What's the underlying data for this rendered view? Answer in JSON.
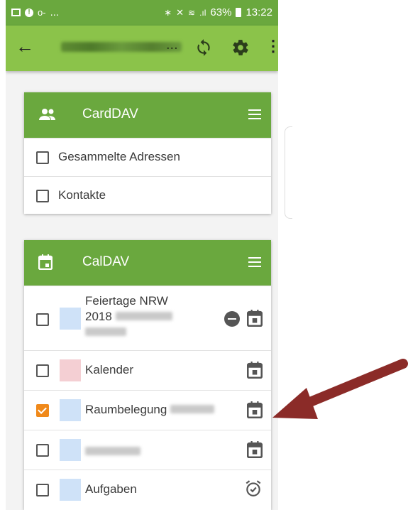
{
  "status_bar": {
    "left_icons": [
      "image-icon",
      "alert-icon",
      "key-icon"
    ],
    "left_text": "...",
    "right_text": "63%",
    "time": "13:22"
  },
  "appbar": {
    "back_icon": "arrow-back-icon",
    "title_visible": "...",
    "actions": [
      "sync-icon",
      "settings-icon",
      "more-icon"
    ]
  },
  "carddav": {
    "title": "CardDAV",
    "items": [
      {
        "label": "Gesammelte Adressen",
        "checked": false
      },
      {
        "label": "Kontakte",
        "checked": false
      }
    ]
  },
  "caldav": {
    "title": "CalDAV",
    "items": [
      {
        "line1": "Feiertage NRW",
        "line2": "2018",
        "checked": false,
        "color": "#cfe2f8",
        "icon": "calendar-icon",
        "extra_icon": "remove-icon"
      },
      {
        "label": "Kalender",
        "checked": false,
        "color": "#f4cfd3",
        "icon": "calendar-icon"
      },
      {
        "label": "Raumbelegung",
        "checked": true,
        "color": "#cfe2f8",
        "icon": "calendar-icon"
      },
      {
        "label": "",
        "checked": false,
        "color": "#cfe2f8",
        "icon": "calendar-icon"
      },
      {
        "label": "Aufgaben",
        "checked": false,
        "color": "#cfe2f8",
        "icon": "alarm-icon"
      }
    ]
  },
  "colors": {
    "primary": "#6aa83e",
    "appbar": "#8bc34a",
    "checked": "#f0891a",
    "arrow": "#8b2b28"
  }
}
